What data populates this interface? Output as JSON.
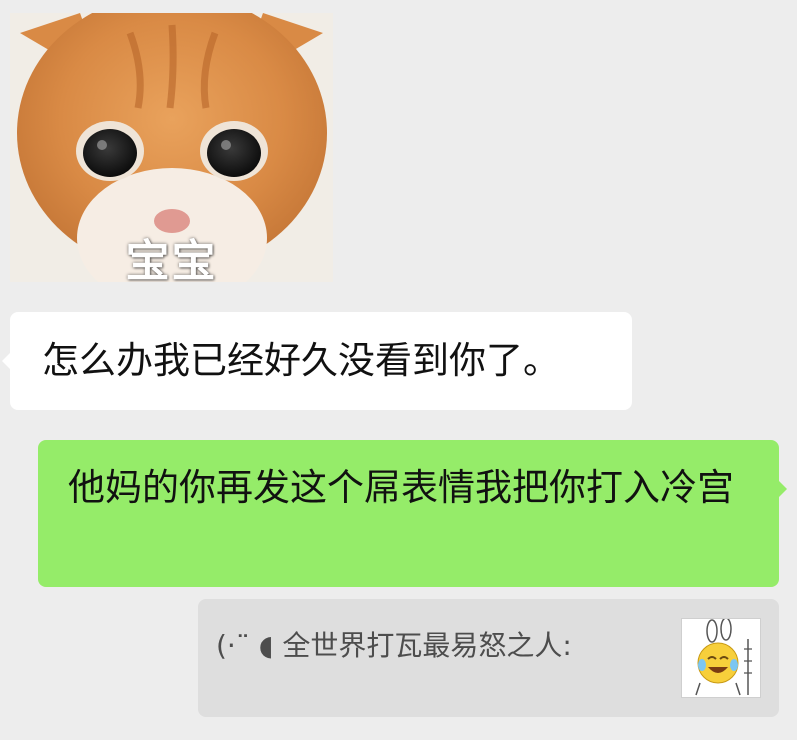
{
  "messages": {
    "sticker": {
      "caption": "宝宝",
      "icon": "crying-kitten-sticker"
    },
    "received_text": "怎么办我已经好久没看到你了。",
    "sent_text": "他妈的你再发这个屌表情我把你打入冷宫",
    "quote": {
      "text": "(·¨ ◖ 全世界打瓦最易怒之人:",
      "thumbnail_icon": "laughing-crying-bunny-sticker"
    }
  },
  "colors": {
    "background": "#ededed",
    "received_bubble": "#ffffff",
    "sent_bubble": "#95ec69",
    "quote_bubble": "#dedede"
  }
}
